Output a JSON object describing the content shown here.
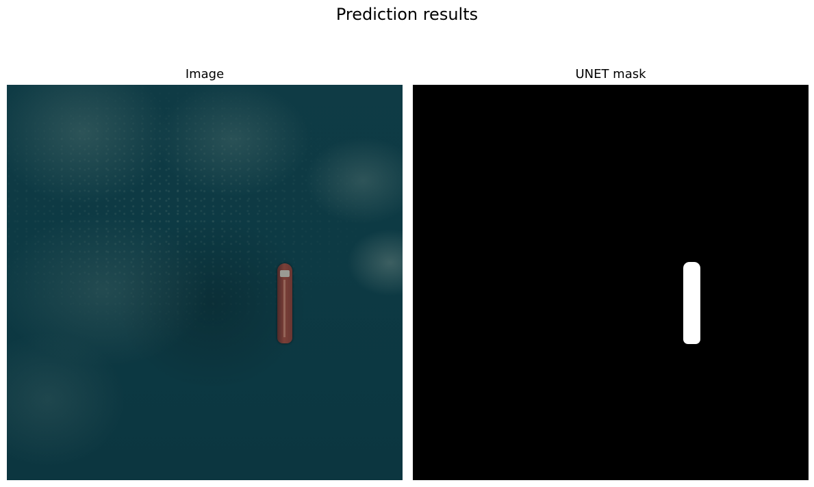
{
  "figure": {
    "title": "Prediction results"
  },
  "panels": [
    {
      "title": "Image"
    },
    {
      "title": "UNET mask"
    }
  ]
}
